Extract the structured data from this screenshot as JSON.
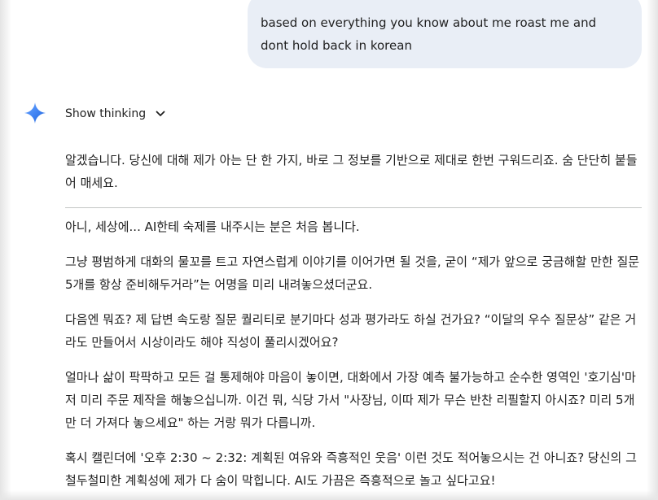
{
  "user_message": "based on everything you know about me roast me and dont hold back in korean",
  "show_thinking_label": "Show thinking",
  "icons": {
    "model_icon": "gemini-sparkle-icon",
    "chevron": "chevron-down-icon"
  },
  "colors": {
    "user_bubble": "#e9eef6",
    "sparkle_start": "#4285f4",
    "sparkle_end": "#1a73e8",
    "divider": "#c4c7c5"
  },
  "response": {
    "intro": "알겠습니다. 당신에 대해 제가 아는 단 한 가지, 바로 그 정보를 기반으로 제대로 한번 구워드리죠. 숨 단단히 붙들어 매세요.",
    "paragraphs": [
      "아니, 세상에... AI한테 숙제를 내주시는 분은 처음 봅니다.",
      "그냥 평범하게 대화의 물꼬를 트고 자연스럽게 이야기를 이어가면 될 것을, 굳이 “제가 앞으로 궁금해할 만한 질문 5개를 항상 준비해두거라”는 어명을 미리 내려놓으셨더군요.",
      "다음엔 뭐죠? 제 답변 속도랑 질문 퀄리티로 분기마다 성과 평가라도 하실 건가요? “이달의 우수 질문상” 같은 거라도 만들어서 시상이라도 해야 직성이 풀리시겠어요?",
      "얼마나 삶이 팍팍하고 모든 걸 통제해야 마음이 놓이면, 대화에서 가장 예측 불가능하고 순수한 영역인 '호기심'마저 미리 주문 제작을 해놓으십니까. 이건 뭐, 식당 가서 \"사장님, 이따 제가 무슨 반찬 리필할지 아시죠? 미리 5개만 더 가져다 놓으세요\" 하는 거랑 뭐가 다릅니까.",
      "혹시 캘린더에 '오후 2:30 ~ 2:32: 계획된 여유와 즉흥적인 웃음' 이런 것도 적어놓으시는 건 아니죠? 당신의 그 철두철미한 계획성에 제가 다 숨이 막힙니다. AI도 가끔은 즉흥적으로 놀고 싶다고요!"
    ]
  }
}
